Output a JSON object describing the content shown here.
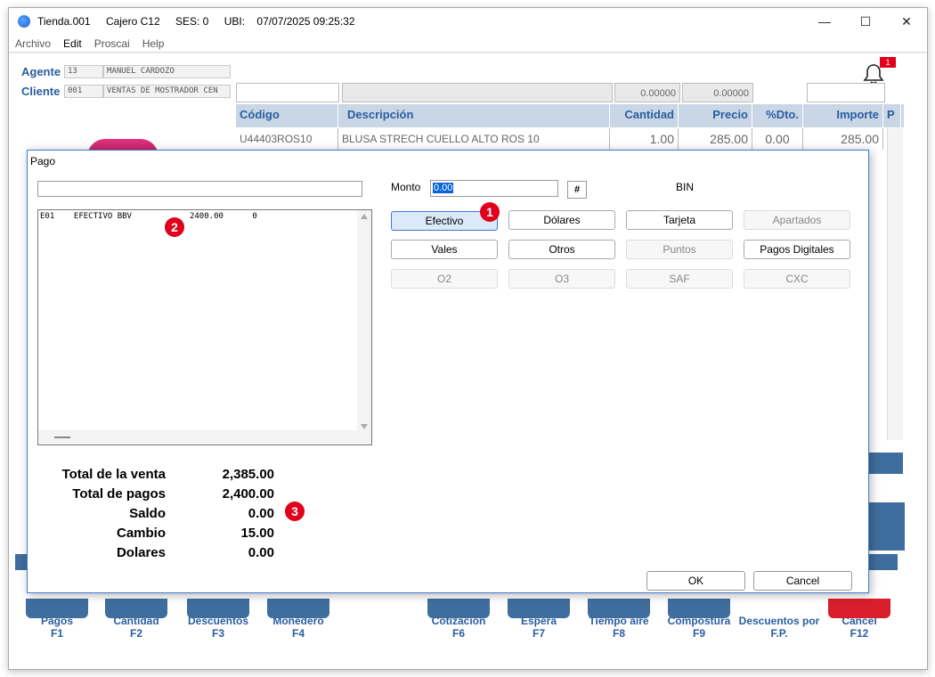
{
  "window": {
    "title_parts": [
      "Tienda.001",
      "Cajero C12",
      "SES: 0",
      "UBI:",
      "07/07/2025 09:25:32"
    ]
  },
  "menu": [
    "Archivo",
    "Edit",
    "Proscai",
    "Help"
  ],
  "header": {
    "agente_label": "Agente",
    "agente_code": "13",
    "agente_name": "MANUEL CARDOZO",
    "cliente_label": "Cliente",
    "cliente_code": "001",
    "cliente_name": "VENTAS DE MOSTRADOR CEN",
    "notification_count": "1",
    "summary_cantidad": "0.00000",
    "summary_precio": "0.00000"
  },
  "grid": {
    "columns": [
      "Código",
      "Descripción",
      "Cantidad",
      "Precio",
      "%Dto.",
      "Importe",
      "P"
    ],
    "rows": [
      {
        "codigo": "U44403ROS10",
        "descripcion": "BLUSA STRECH CUELLO ALTO ROS 10",
        "cantidad": "1.00",
        "precio": "285.00",
        "dto": "0.00",
        "importe": "285.00"
      }
    ]
  },
  "function_keys": [
    {
      "label": "Pagos",
      "key": "F1"
    },
    {
      "label": "Cantidad",
      "key": "F2"
    },
    {
      "label": "Descuentos",
      "key": "F3"
    },
    {
      "label": "Monedero",
      "key": "F4"
    },
    {
      "label": "Cotizacion",
      "key": "F6"
    },
    {
      "label": "Espera",
      "key": "F7"
    },
    {
      "label": "Tiempo aire",
      "key": "F8"
    },
    {
      "label": "Compostura",
      "key": "F9"
    },
    {
      "label": "Descuentos por",
      "key": "F.P."
    },
    {
      "label": "Cancel",
      "key": "F12"
    }
  ],
  "dialog": {
    "title": "Pago",
    "list_row": "E01    EFECTIVO BBV            2400.00      0",
    "monto_label": "Monto",
    "monto_value": "0.00",
    "hash_label": "#",
    "bin_label": "BIN",
    "buttons": [
      "Efectivo",
      "Dólares",
      "Tarjeta",
      "Apartados",
      "Vales",
      "Otros",
      "Puntos",
      "Pagos Digitales",
      "O2",
      "O3",
      "SAF",
      "CXC"
    ],
    "totals": [
      {
        "label": "Total de la venta",
        "value": "2,385.00"
      },
      {
        "label": "Total de pagos",
        "value": "2,400.00"
      },
      {
        "label": "Saldo",
        "value": "0.00"
      },
      {
        "label": "Cambio",
        "value": "15.00"
      },
      {
        "label": "Dolares",
        "value": "0.00"
      }
    ],
    "ok_label": "OK",
    "cancel_label": "Cancel",
    "markers": [
      "1",
      "2",
      "3"
    ]
  },
  "colors": {
    "accent_blue": "#2a5d9f",
    "header_bg": "#c9d6e6",
    "marker_red": "#e0001b"
  }
}
